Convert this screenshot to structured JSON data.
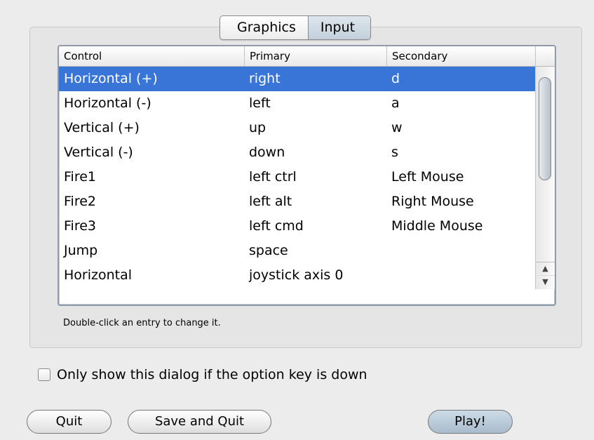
{
  "tabs": [
    {
      "label": "Graphics",
      "selected": false
    },
    {
      "label": "Input",
      "selected": true
    }
  ],
  "table": {
    "columns": [
      "Control",
      "Primary",
      "Secondary"
    ],
    "rows": [
      {
        "control": "Horizontal (+)",
        "primary": "right",
        "secondary": "d",
        "selected": true
      },
      {
        "control": "Horizontal (-)",
        "primary": "left",
        "secondary": "a"
      },
      {
        "control": "Vertical (+)",
        "primary": "up",
        "secondary": "w"
      },
      {
        "control": "Vertical (-)",
        "primary": "down",
        "secondary": "s"
      },
      {
        "control": "Fire1",
        "primary": "left ctrl",
        "secondary": "Left Mouse"
      },
      {
        "control": "Fire2",
        "primary": "left alt",
        "secondary": "Right Mouse"
      },
      {
        "control": "Fire3",
        "primary": "left cmd",
        "secondary": "Middle Mouse"
      },
      {
        "control": "Jump",
        "primary": "space",
        "secondary": ""
      },
      {
        "control": "Horizontal",
        "primary": "joystick axis 0",
        "secondary": ""
      }
    ]
  },
  "hint": "Double-click an entry to change it.",
  "option_checkbox": {
    "label": "Only show this dialog if the option key is down",
    "checked": false
  },
  "buttons": {
    "quit": "Quit",
    "save_quit": "Save and Quit",
    "play": "Play!"
  },
  "colors": {
    "selection": "#3875d7"
  }
}
